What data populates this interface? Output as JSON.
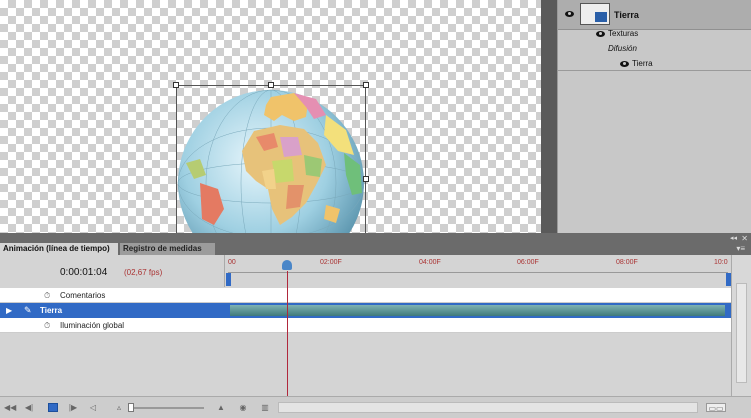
{
  "layers_panel": {
    "layer_name": "Tierra",
    "textures_label": "Texturas",
    "diffusion_label": "Difusión",
    "texture_item": "Tierra"
  },
  "timeline": {
    "tab_animation": "Animación (línea de tiempo)",
    "tab_measures": "Registro de medidas",
    "timecode": "0:00:01:04",
    "fps": "(02,67 fps)",
    "ruler_labels": [
      "00",
      "02:00F",
      "04:00F",
      "06:00F",
      "08:00F",
      "10:0"
    ],
    "rows": {
      "comments": "Comentarios",
      "layer": "Tierra",
      "global_light": "Iluminación global"
    }
  },
  "colors": {
    "accent": "#316ac5",
    "playhead": "#b0283c",
    "clip": "#4f8f8f"
  },
  "icons": [
    "eye-icon",
    "first-frame-icon",
    "prev-frame-icon",
    "stop-icon",
    "next-frame-icon",
    "audio-icon",
    "zoom-out-icon",
    "zoom-in-icon",
    "render-icon",
    "delete-icon",
    "menu-icon"
  ]
}
